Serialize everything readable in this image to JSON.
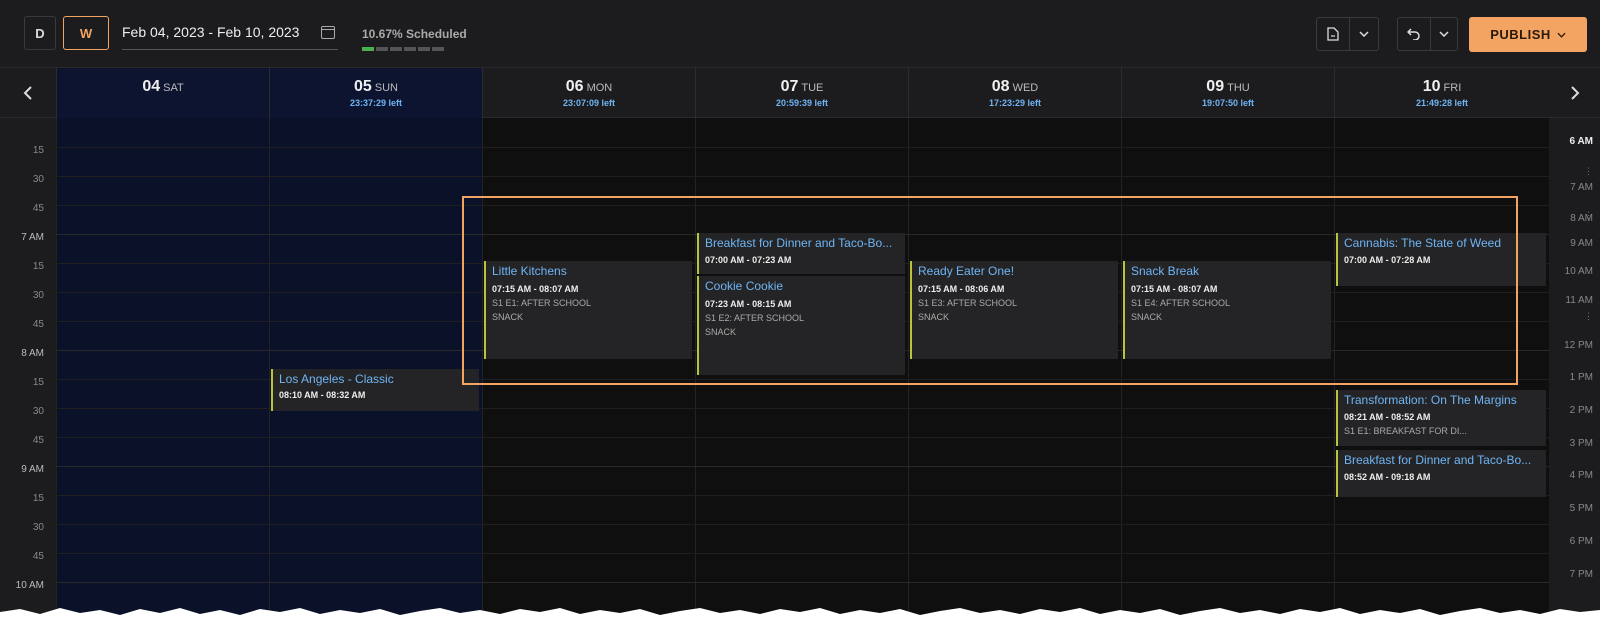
{
  "toolbar": {
    "day_view_label": "D",
    "week_view_label": "W",
    "date_range": "Feb 04, 2023 - Feb 10, 2023",
    "scheduled_text": "10.67% Scheduled",
    "scheduled_progress": 0.1067,
    "publish_label": "PUBLISH",
    "accent_color": "#f4a462"
  },
  "icons": {
    "calendar": "calendar-icon",
    "document": "document-icon",
    "undo": "undo-icon",
    "chevron_down": "chevron-down-icon",
    "prev": "chevron-left-icon",
    "next": "chevron-right-icon"
  },
  "days": [
    {
      "num": "04",
      "name": "SAT",
      "left": ""
    },
    {
      "num": "05",
      "name": "SUN",
      "left": "23:37:29 left"
    },
    {
      "num": "06",
      "name": "MON",
      "left": "23:07:09 left"
    },
    {
      "num": "07",
      "name": "TUE",
      "left": "20:59:39 left"
    },
    {
      "num": "08",
      "name": "WED",
      "left": "17:23:29 left"
    },
    {
      "num": "09",
      "name": "THU",
      "left": "19:07:50 left"
    },
    {
      "num": "10",
      "name": "FRI",
      "left": "21:49:28 left"
    }
  ],
  "time_labels": [
    "15",
    "30",
    "45",
    "7 AM",
    "15",
    "30",
    "45",
    "8 AM",
    "15",
    "30",
    "45",
    "9 AM",
    "15",
    "30",
    "45",
    "10 AM"
  ],
  "right_hours": [
    "6 AM",
    "7 AM",
    "8 AM",
    "9 AM",
    "10 AM",
    "11 AM",
    "12 PM",
    "1 PM",
    "2 PM",
    "3 PM",
    "4 PM",
    "5 PM",
    "6 PM",
    "7 PM"
  ],
  "events": [
    {
      "title": "Los Angeles - Classic",
      "time": "08:10 AM - 08:32 AM",
      "sub1": "",
      "sub2": ""
    },
    {
      "title": "Little Kitchens",
      "time": "07:15 AM - 08:07 AM",
      "sub1": "S1 E1: AFTER SCHOOL",
      "sub2": "SNACK"
    },
    {
      "title": "Breakfast for Dinner and Taco-Bo...",
      "time": "07:00 AM - 07:23 AM",
      "sub1": "",
      "sub2": ""
    },
    {
      "title": "Cookie Cookie",
      "time": "07:23 AM - 08:15 AM",
      "sub1": "S1 E2: AFTER SCHOOL",
      "sub2": "SNACK"
    },
    {
      "title": "Ready Eater One!",
      "time": "07:15 AM - 08:06 AM",
      "sub1": "S1 E3: AFTER SCHOOL",
      "sub2": "SNACK"
    },
    {
      "title": "Snack Break",
      "time": "07:15 AM - 08:07 AM",
      "sub1": "S1 E4: AFTER SCHOOL",
      "sub2": "SNACK"
    },
    {
      "title": "Cannabis: The State of Weed",
      "time": "07:00 AM - 07:28 AM",
      "sub1": "",
      "sub2": ""
    },
    {
      "title": "Transformation: On The Margins",
      "time": "08:21 AM - 08:52 AM",
      "sub1": "S1 E1: BREAKFAST FOR DI...",
      "sub2": ""
    },
    {
      "title": "Breakfast for Dinner and Taco-Bo...",
      "time": "08:52 AM - 09:18 AM",
      "sub1": "",
      "sub2": ""
    }
  ]
}
